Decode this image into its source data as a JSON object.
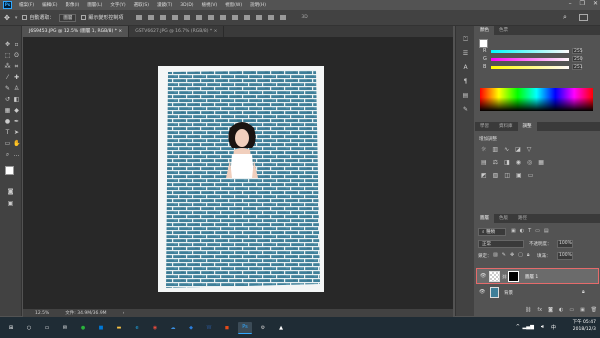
{
  "app": {
    "logo_text": "Ps"
  },
  "menu": [
    "檔案(F)",
    "編輯(E)",
    "影像(I)",
    "圖層(L)",
    "文字(Y)",
    "選取(S)",
    "濾鏡(T)",
    "3D(D)",
    "檢視(V)",
    "視窗(W)",
    "說明(H)"
  ],
  "options": {
    "auto_select_label": "自動選取：",
    "auto_select_value": "圖層",
    "show_transform_label": "顯示變形控制項"
  },
  "tabs": [
    {
      "label": "J6S9453.JPG @ 12.5% (圖層 1, RGB/8) *"
    },
    {
      "label": "GSTV6627.JPG @ 16.7% (RGB/8) *"
    }
  ],
  "status": {
    "zoom": "12.5%",
    "doc": "文件: 34.9M/36.9M"
  },
  "color_panel": {
    "tabs": [
      "顏色",
      "色票"
    ],
    "sliders": [
      {
        "label": "R",
        "value": "255",
        "gradient": "#ff4f4f"
      },
      {
        "label": "G",
        "value": "250",
        "gradient": "#3fd06a"
      },
      {
        "label": "B",
        "value": "251",
        "gradient": "#4f7dff"
      }
    ]
  },
  "adjust_panel": {
    "tabs": [
      "學習",
      "資料庫",
      "調整"
    ],
    "title": "增加調整"
  },
  "layers_panel": {
    "tabs": [
      "圖層",
      "色版",
      "路徑"
    ],
    "kind": "種類",
    "blend": "正常",
    "opacity_label": "不透明度：",
    "opacity": "100%",
    "lock_label": "鎖定：",
    "fill_label": "填滿：",
    "fill": "100%",
    "layers": [
      {
        "name": "圖層 1",
        "selected": true
      },
      {
        "name": "背景",
        "selected": false
      }
    ]
  },
  "taskbar": {
    "time": "下午 05:47",
    "date": "2018/12/3",
    "tray": "中",
    "apps": [
      {
        "icon": "windows-icon",
        "color": "#ffffff"
      },
      {
        "icon": "cortana-icon",
        "color": "#ffffff"
      },
      {
        "icon": "taskview-icon",
        "color": "#ffffff"
      },
      {
        "icon": "mail-icon",
        "color": "#ffffff"
      },
      {
        "icon": "line-icon",
        "color": "#29b33b"
      },
      {
        "icon": "store-icon",
        "color": "#0078d7"
      },
      {
        "icon": "explorer-icon",
        "color": "#f7c244"
      },
      {
        "icon": "edge-icon",
        "color": "#1fa3e0"
      },
      {
        "icon": "chrome-icon",
        "color": "#e44a3c"
      },
      {
        "icon": "onedrive-icon",
        "color": "#3a8fe0"
      },
      {
        "icon": "dropbox-icon",
        "color": "#2b7ddb"
      },
      {
        "icon": "word-icon",
        "color": "#2b5797"
      },
      {
        "icon": "office-icon",
        "color": "#e64a19"
      },
      {
        "icon": "photoshop-icon",
        "color": "#31a8ff"
      },
      {
        "icon": "settings-icon",
        "color": "#cccccc"
      },
      {
        "icon": "photos-icon",
        "color": "#ffffff"
      }
    ]
  }
}
